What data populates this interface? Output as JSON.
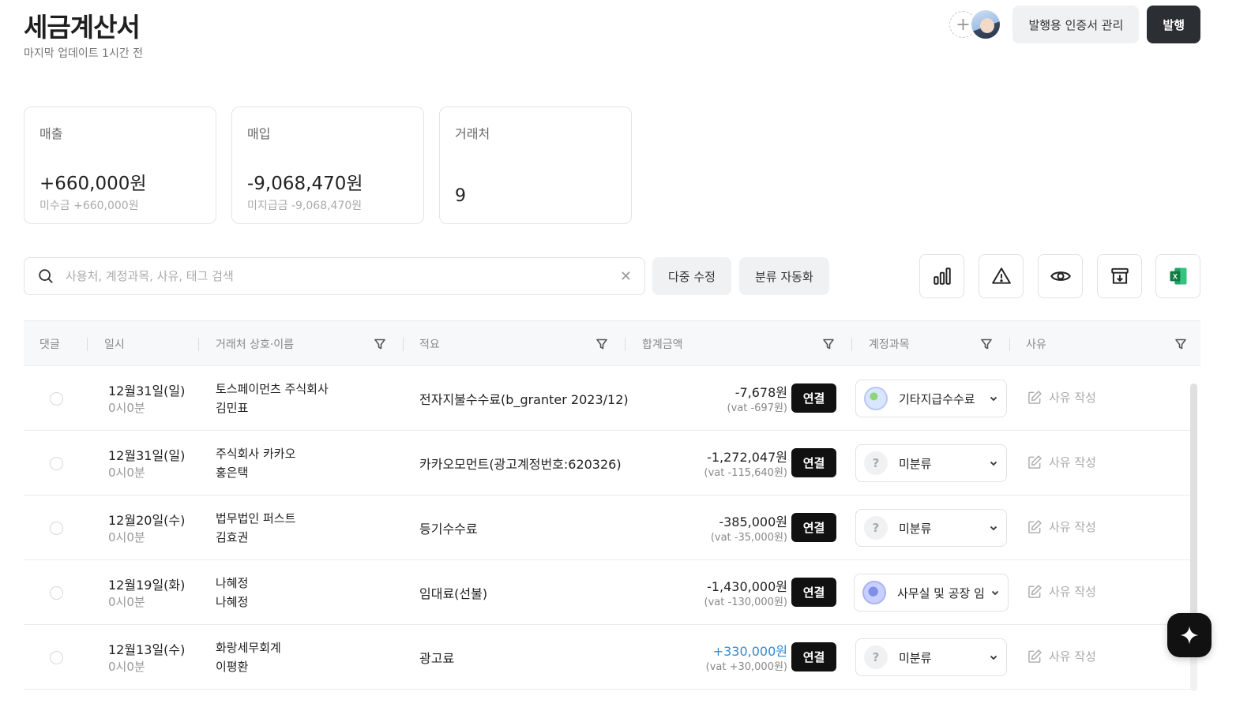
{
  "header": {
    "title": "세금계산서",
    "subtitle": "마지막 업데이트 1시간 전",
    "add_member_symbol": "+",
    "cert_button": "발행용 인증서 관리",
    "issue_button": "발행"
  },
  "cards": {
    "sales": {
      "label": "매출",
      "value": "+660,000원",
      "sub": "미수금 +660,000원"
    },
    "purchase": {
      "label": "매입",
      "value": "-9,068,470원",
      "sub": "미지급금 -9,068,470원"
    },
    "vendors": {
      "label": "거래처",
      "count": "9"
    }
  },
  "toolbar": {
    "search_placeholder": "사용처, 계정과목, 사유, 태그 검색",
    "clear_symbol": "✕",
    "bulk_edit": "다중 수정",
    "auto_classify": "분류 자동화",
    "icons": [
      "bar-chart-icon",
      "warning-icon",
      "eye-icon",
      "archive-download-icon",
      "excel-icon"
    ]
  },
  "table": {
    "headers": {
      "comment": "댓글",
      "date": "일시",
      "vendor": "거래처 상호·이름",
      "memo": "적요",
      "amount": "합계금액",
      "account": "계정과목",
      "reason": "사유"
    },
    "link_label": "연결",
    "reason_label": "사유 작성",
    "rows": [
      {
        "date": "12월31일(일)",
        "time": "0시0분",
        "vendor": "토스페이먼츠 주식회사",
        "person": "김민표",
        "memo": "전자지불수수료(b_granter 2023/12)",
        "amount": "-7,678원",
        "vat": "(vat -697원)",
        "account": "기타지급수수료",
        "account_icon": "fee-icon"
      },
      {
        "date": "12월31일(일)",
        "time": "0시0분",
        "vendor": "주식회사 카카오",
        "person": "홍은택",
        "memo": "카카오모먼트(광고계정번호:620326)",
        "amount": "-1,272,047원",
        "vat": "(vat -115,640원)",
        "account": "미분류",
        "account_icon": "question-icon"
      },
      {
        "date": "12월20일(수)",
        "time": "0시0분",
        "vendor": "법무법인 퍼스트",
        "person": "김효권",
        "memo": "등기수수료",
        "amount": "-385,000원",
        "vat": "(vat -35,000원)",
        "account": "미분류",
        "account_icon": "question-icon"
      },
      {
        "date": "12월19일(화)",
        "time": "0시0분",
        "vendor": "나혜정",
        "person": "나혜정",
        "memo": "임대료(선불)",
        "amount": "-1,430,000원",
        "vat": "(vat -130,000원)",
        "account": "사무실 및 공장 임",
        "account_icon": "office-icon"
      },
      {
        "date": "12월13일(수)",
        "time": "0시0분",
        "vendor": "화랑세무회계",
        "person": "이평환",
        "memo": "광고료",
        "amount": "+330,000원",
        "vat": "(vat +30,000원)",
        "account": "미분류",
        "account_icon": "question-icon"
      }
    ]
  },
  "colors": {
    "positive_amount": "#2e8bd6",
    "primary_dark": "#2b2e33",
    "excel_green": "#1d7a45"
  }
}
